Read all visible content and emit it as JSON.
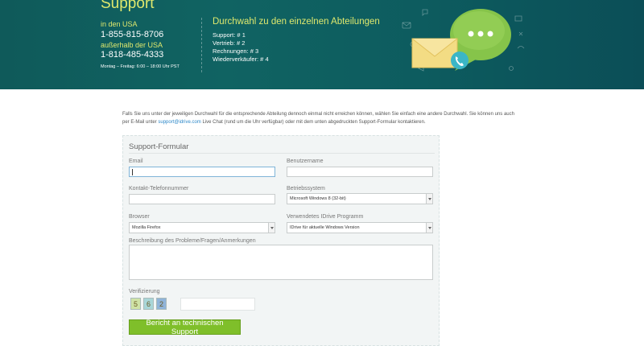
{
  "banner": {
    "title": "Support",
    "usa_label": "in den USA",
    "usa_phone": "1-855-815-8706",
    "intl_label": "außerhalb der USA",
    "intl_phone": "1-818-485-4333",
    "hours": "Montag – Freitag: 6:00 – 18:00 Uhr PST",
    "dept_title": "Durchwahl zu den einzelnen Abteilungen",
    "departments": [
      "Support: # 1",
      "Vertrieb: # 2",
      "Rechnungen: # 3",
      "Wiederverkäufer: # 4"
    ]
  },
  "intro": {
    "text_before": "Falls Sie uns unter der jeweiligen Durchwahl für die entsprechende Abteilung dennoch einmal nicht erreichen können, wählen Sie einfach eine andere Durchwahl. Sie können uns auch per E-Mail unter ",
    "email": "support@idrive.com",
    "text_after": " Live Chat (rund um die Uhr verfügbar) oder mit dem unten abgedruckten Support-Formular kontaktieren."
  },
  "form": {
    "title": "Support-Formular",
    "email_label": "Email",
    "username_label": "Benutzername",
    "phone_label": "Kontakt-Telefonnummer",
    "os_label": "Betriebssystem",
    "os_value": "Microsoft Windows 8 (32-bit)",
    "browser_label": "Browser",
    "browser_value": "Mozilla Firefox",
    "program_label": "Verwendetes IDrive Programm",
    "program_value": "IDrive für aktuelle Windows Version",
    "description_label": "Beschreibung des Probleme/Fragen/Anmerkungen",
    "verification_label": "Verifizierung",
    "captcha": [
      "5",
      "6",
      "2"
    ],
    "submit_label": "Bericht an technischen Support"
  },
  "colors": {
    "banner": "#106362",
    "accent_yellow": "#dfe86d",
    "link": "#2d88c9",
    "submit": "#7fbf2a"
  }
}
